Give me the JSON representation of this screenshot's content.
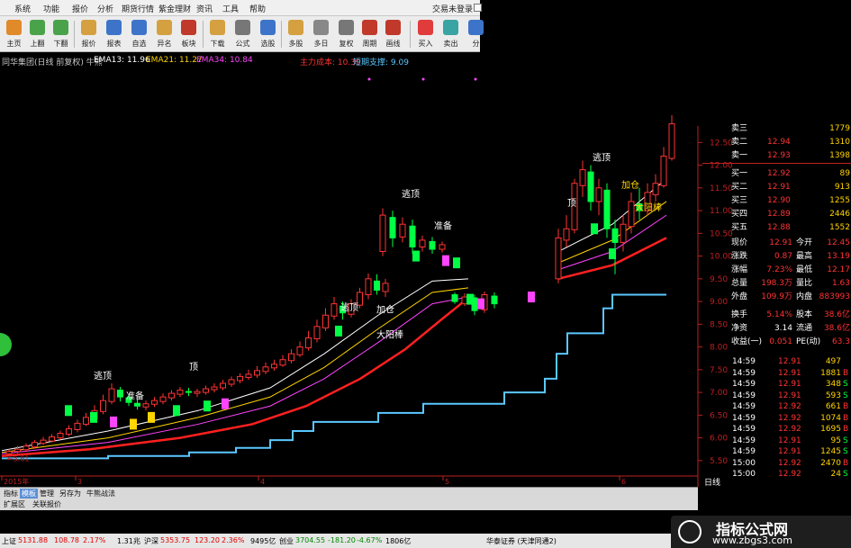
{
  "menu": {
    "items": [
      "系统",
      "功能",
      "报价",
      "分析",
      "期货行情",
      "紫金理财",
      "资讯",
      "工具",
      "帮助"
    ],
    "trade_login": "交易未登录"
  },
  "toolbar": {
    "buttons": [
      {
        "label": "主页",
        "icon": "home-icon",
        "color": "#e08a2a"
      },
      {
        "label": "上翻",
        "icon": "page-up-icon",
        "color": "#4aa34a"
      },
      {
        "label": "下翻",
        "icon": "page-down-icon",
        "color": "#4aa34a"
      },
      {
        "label": "报价",
        "icon": "quote-icon",
        "color": "#d4a040"
      },
      {
        "label": "报表",
        "icon": "report-icon",
        "color": "#3d74c9"
      },
      {
        "label": "自选",
        "icon": "watchlist-icon",
        "color": "#3d74c9"
      },
      {
        "label": "异名",
        "icon": "rank-icon",
        "color": "#d4a040"
      },
      {
        "label": "板块",
        "icon": "sector-icon",
        "color": "#c0392b"
      },
      {
        "label": "下载",
        "icon": "download-icon",
        "color": "#d4a040"
      },
      {
        "label": "公式",
        "icon": "formula-icon",
        "color": "#777777"
      },
      {
        "label": "选股",
        "icon": "stock-picker-icon",
        "color": "#3d74c9"
      },
      {
        "label": "多股",
        "icon": "multi-stock-icon",
        "color": "#d4a040"
      },
      {
        "label": "多日",
        "icon": "multi-day-icon",
        "color": "#888888"
      },
      {
        "label": "复权",
        "icon": "adjust-icon",
        "color": "#777777"
      },
      {
        "label": "周期",
        "icon": "period-icon",
        "color": "#c0392b"
      },
      {
        "label": "画线",
        "icon": "draw-line-icon",
        "color": "#c0392b"
      },
      {
        "label": "买入",
        "icon": "buy-icon",
        "color": "#e03c3c"
      },
      {
        "label": "卖出",
        "icon": "sell-icon",
        "color": "#3aa3a3"
      },
      {
        "label": "分",
        "icon": "split-icon",
        "color": "#3d74c9"
      }
    ]
  },
  "chart_header": {
    "title": "同华集团(日线 前复权) 牛熊",
    "ema13": "EMA13: 11.96",
    "ema21": "EMA21: 11.27",
    "ema34": "EMA34: 10.84",
    "cost": "主力成本: 10.39",
    "support": "短期支撑: 9.09"
  },
  "chart_data": {
    "type": "candlestick",
    "x_tick_labels": [
      "2015年",
      "3",
      "4",
      "5",
      "6"
    ],
    "y_tick_labels": [
      "5.50",
      "6.00",
      "6.50",
      "7.00",
      "7.50",
      "8.00",
      "8.50",
      "9.00",
      "9.50",
      "10.00",
      "10.50",
      "11.00",
      "11.50",
      "12.00",
      "12.50"
    ],
    "ylim": [
      5.2,
      13.1
    ],
    "low_label": "5.61",
    "annotations": [
      "逃顶",
      "准备",
      "顶",
      "加仓",
      "大阳棒",
      "逃顶",
      "准备",
      "逃顶",
      "顶",
      "逃顶",
      "加仓",
      "大阳棒"
    ],
    "series": [
      {
        "kind": "candles",
        "open_close_high_low": [
          [
            5.65,
            5.7,
            5.75,
            5.6
          ],
          [
            5.7,
            5.75,
            5.82,
            5.66
          ],
          [
            5.74,
            5.82,
            5.88,
            5.7
          ],
          [
            5.8,
            5.9,
            5.95,
            5.76
          ],
          [
            5.88,
            5.95,
            6.02,
            5.84
          ],
          [
            5.93,
            6.02,
            6.08,
            5.9
          ],
          [
            6.0,
            6.1,
            6.16,
            5.96
          ],
          [
            6.08,
            6.2,
            6.28,
            6.04
          ],
          [
            6.18,
            6.32,
            6.4,
            6.12
          ],
          [
            6.3,
            6.45,
            6.55,
            6.26
          ],
          [
            6.42,
            6.6,
            6.72,
            6.38
          ],
          [
            6.58,
            6.82,
            6.95,
            6.52
          ],
          [
            6.8,
            7.08,
            7.2,
            6.74
          ],
          [
            7.05,
            6.9,
            7.12,
            6.8
          ],
          [
            6.88,
            6.78,
            6.95,
            6.7
          ],
          [
            6.76,
            6.7,
            6.84,
            6.62
          ],
          [
            6.68,
            6.75,
            6.82,
            6.6
          ],
          [
            6.74,
            6.82,
            6.9,
            6.68
          ],
          [
            6.8,
            6.9,
            6.98,
            6.74
          ],
          [
            6.88,
            6.98,
            7.05,
            6.82
          ],
          [
            6.96,
            7.05,
            7.12,
            6.9
          ],
          [
            7.02,
            7.0,
            7.1,
            6.92
          ],
          [
            6.98,
            7.02,
            7.08,
            6.9
          ],
          [
            7.0,
            7.08,
            7.15,
            6.95
          ],
          [
            7.06,
            7.12,
            7.2,
            7.0
          ],
          [
            7.1,
            7.2,
            7.28,
            7.05
          ],
          [
            7.18,
            7.28,
            7.35,
            7.12
          ],
          [
            7.26,
            7.35,
            7.42,
            7.2
          ],
          [
            7.33,
            7.4,
            7.5,
            7.28
          ],
          [
            7.38,
            7.48,
            7.58,
            7.32
          ],
          [
            7.46,
            7.56,
            7.66,
            7.4
          ],
          [
            7.54,
            7.62,
            7.72,
            7.48
          ],
          [
            7.6,
            7.72,
            7.82,
            7.56
          ],
          [
            7.7,
            7.85,
            7.95,
            7.64
          ],
          [
            7.83,
            8.0,
            8.12,
            7.78
          ],
          [
            7.98,
            8.2,
            8.35,
            7.92
          ],
          [
            8.18,
            8.45,
            8.6,
            8.1
          ],
          [
            8.42,
            8.7,
            8.85,
            8.35
          ],
          [
            8.68,
            8.95,
            9.1,
            8.6
          ],
          [
            8.9,
            8.75,
            9.0,
            8.6
          ],
          [
            8.72,
            8.95,
            9.05,
            8.65
          ],
          [
            8.92,
            9.2,
            9.3,
            8.85
          ],
          [
            9.15,
            9.5,
            9.62,
            9.05
          ],
          [
            9.45,
            9.25,
            9.6,
            9.15
          ],
          [
            9.22,
            9.4,
            9.5,
            9.1
          ]
        ]
      },
      {
        "kind": "candles",
        "open_close_high_low": [
          [
            10.1,
            10.9,
            11.05,
            10.0
          ],
          [
            10.85,
            10.4,
            11.0,
            10.2
          ],
          [
            10.42,
            10.7,
            10.85,
            10.3
          ],
          [
            10.66,
            10.2,
            10.8,
            10.05
          ],
          [
            10.2,
            10.35,
            10.45,
            10.1
          ],
          [
            10.32,
            10.15,
            10.42,
            10.05
          ],
          [
            10.15,
            10.25,
            10.32,
            10.08
          ]
        ]
      },
      {
        "kind": "candles",
        "open_close_high_low": [
          [
            9.15,
            9.0,
            9.2,
            8.95
          ],
          [
            8.95,
            9.1,
            9.18,
            8.9
          ],
          [
            9.08,
            8.8,
            9.15,
            8.7
          ],
          [
            8.82,
            9.15,
            9.22,
            8.75
          ],
          [
            9.12,
            8.95,
            9.2,
            8.85
          ]
        ]
      },
      {
        "kind": "candles",
        "open_close_high_low": [
          [
            9.5,
            10.4,
            10.6,
            9.4
          ],
          [
            10.35,
            10.6,
            10.9,
            10.2
          ],
          [
            10.58,
            11.6,
            11.7,
            10.5
          ],
          [
            11.55,
            11.9,
            12.1,
            11.3
          ],
          [
            11.85,
            11.2,
            12.0,
            11.0
          ],
          [
            11.2,
            11.5,
            11.7,
            10.9
          ],
          [
            11.45,
            10.6,
            11.6,
            10.4
          ],
          [
            10.6,
            10.3,
            10.8,
            9.6
          ],
          [
            10.3,
            10.7,
            10.9,
            10.1
          ],
          [
            10.65,
            11.2,
            11.4,
            10.5
          ],
          [
            11.15,
            11.0,
            11.5,
            10.8
          ],
          [
            11.0,
            11.4,
            11.6,
            10.9
          ],
          [
            11.35,
            11.6,
            11.8,
            11.2
          ],
          [
            11.55,
            12.2,
            12.4,
            11.5
          ],
          [
            12.15,
            12.91,
            13.1,
            12.1
          ]
        ]
      }
    ]
  },
  "quotes": {
    "order_book": [
      {
        "label": "卖三",
        "price": "",
        "vol": "1779"
      },
      {
        "label": "卖二",
        "price": "12.94",
        "vol": "1310"
      },
      {
        "label": "卖一",
        "price": "12.93",
        "vol": "1398"
      },
      {
        "label": "买一",
        "price": "12.92",
        "vol": "89"
      },
      {
        "label": "买二",
        "price": "12.91",
        "vol": "913"
      },
      {
        "label": "买三",
        "price": "12.90",
        "vol": "1255"
      },
      {
        "label": "买四",
        "price": "12.89",
        "vol": "2446"
      },
      {
        "label": "买五",
        "price": "12.88",
        "vol": "1552"
      }
    ],
    "stats": [
      {
        "l1": "现价",
        "v1": "12.91",
        "l2": "今开",
        "v2": "12.45"
      },
      {
        "l1": "涨跌",
        "v1": "0.87",
        "l2": "最高",
        "v2": "13.19"
      },
      {
        "l1": "涨幅",
        "v1": "7.23%",
        "l2": "最低",
        "v2": "12.17"
      },
      {
        "l1": "总量",
        "v1": "198.3万",
        "l2": "量比",
        "v2": "1.63"
      },
      {
        "l1": "外盘",
        "v1": "109.9万",
        "l2": "内盘",
        "v2": "883993"
      },
      {
        "l1": "换手",
        "v1": "5.14%",
        "l2": "股本",
        "v2": "38.6亿"
      },
      {
        "l1": "净资",
        "v1": "3.14",
        "l2": "流通",
        "v2": "38.6亿"
      },
      {
        "l1": "收益(一)",
        "v1": "0.051",
        "l2": "PE(动)",
        "v2": "63.3"
      }
    ],
    "ticks": [
      {
        "t": "14:59",
        "p": "12.91",
        "v": "497",
        "f": ""
      },
      {
        "t": "14:59",
        "p": "12.91",
        "v": "1881",
        "f": "B"
      },
      {
        "t": "14:59",
        "p": "12.91",
        "v": "348",
        "f": "S"
      },
      {
        "t": "14:59",
        "p": "12.91",
        "v": "593",
        "f": "S"
      },
      {
        "t": "14:59",
        "p": "12.92",
        "v": "661",
        "f": "B"
      },
      {
        "t": "14:59",
        "p": "12.92",
        "v": "1074",
        "f": "B"
      },
      {
        "t": "14:59",
        "p": "12.92",
        "v": "1695",
        "f": "B"
      },
      {
        "t": "14:59",
        "p": "12.91",
        "v": "95",
        "f": "S"
      },
      {
        "t": "14:59",
        "p": "12.91",
        "v": "1245",
        "f": "S"
      },
      {
        "t": "15:00",
        "p": "12.92",
        "v": "2470",
        "f": "B"
      },
      {
        "t": "15:00",
        "p": "12.92",
        "v": "24",
        "f": "S"
      }
    ],
    "period_label": "日线"
  },
  "bottom_tabs": [
    "指标",
    "模板",
    "管理",
    "另存为",
    "牛熊战法"
  ],
  "ext_tabs": [
    "扩展区",
    "关联报价"
  ],
  "status": {
    "sh_label": "上证",
    "sh_val": "5131.88",
    "sh_chg": "108.78",
    "sh_pct": "2.17%",
    "sh_amt": "1.31兆",
    "sz_label": "沪深",
    "sz_val": "5353.75",
    "sz_chg": "123.20",
    "sz_pct": "2.36%",
    "sz_amt": "9495亿",
    "cy_label": "创业",
    "cy_val": "3704.55",
    "cy_chg": "-181.20",
    "cy_pct": "-4.67%",
    "cy_amt": "1806亿",
    "broker": "华泰证券 (天津同通2)"
  },
  "watermark": {
    "title": "指标公式网",
    "url": "www.zbgs3.com"
  },
  "colors": {
    "up": "#ff3333",
    "down": "#00ff44",
    "cyan": "#5bc8ff",
    "yellow": "#ffd400",
    "magenta": "#ff44ff",
    "white": "#ffffff"
  }
}
